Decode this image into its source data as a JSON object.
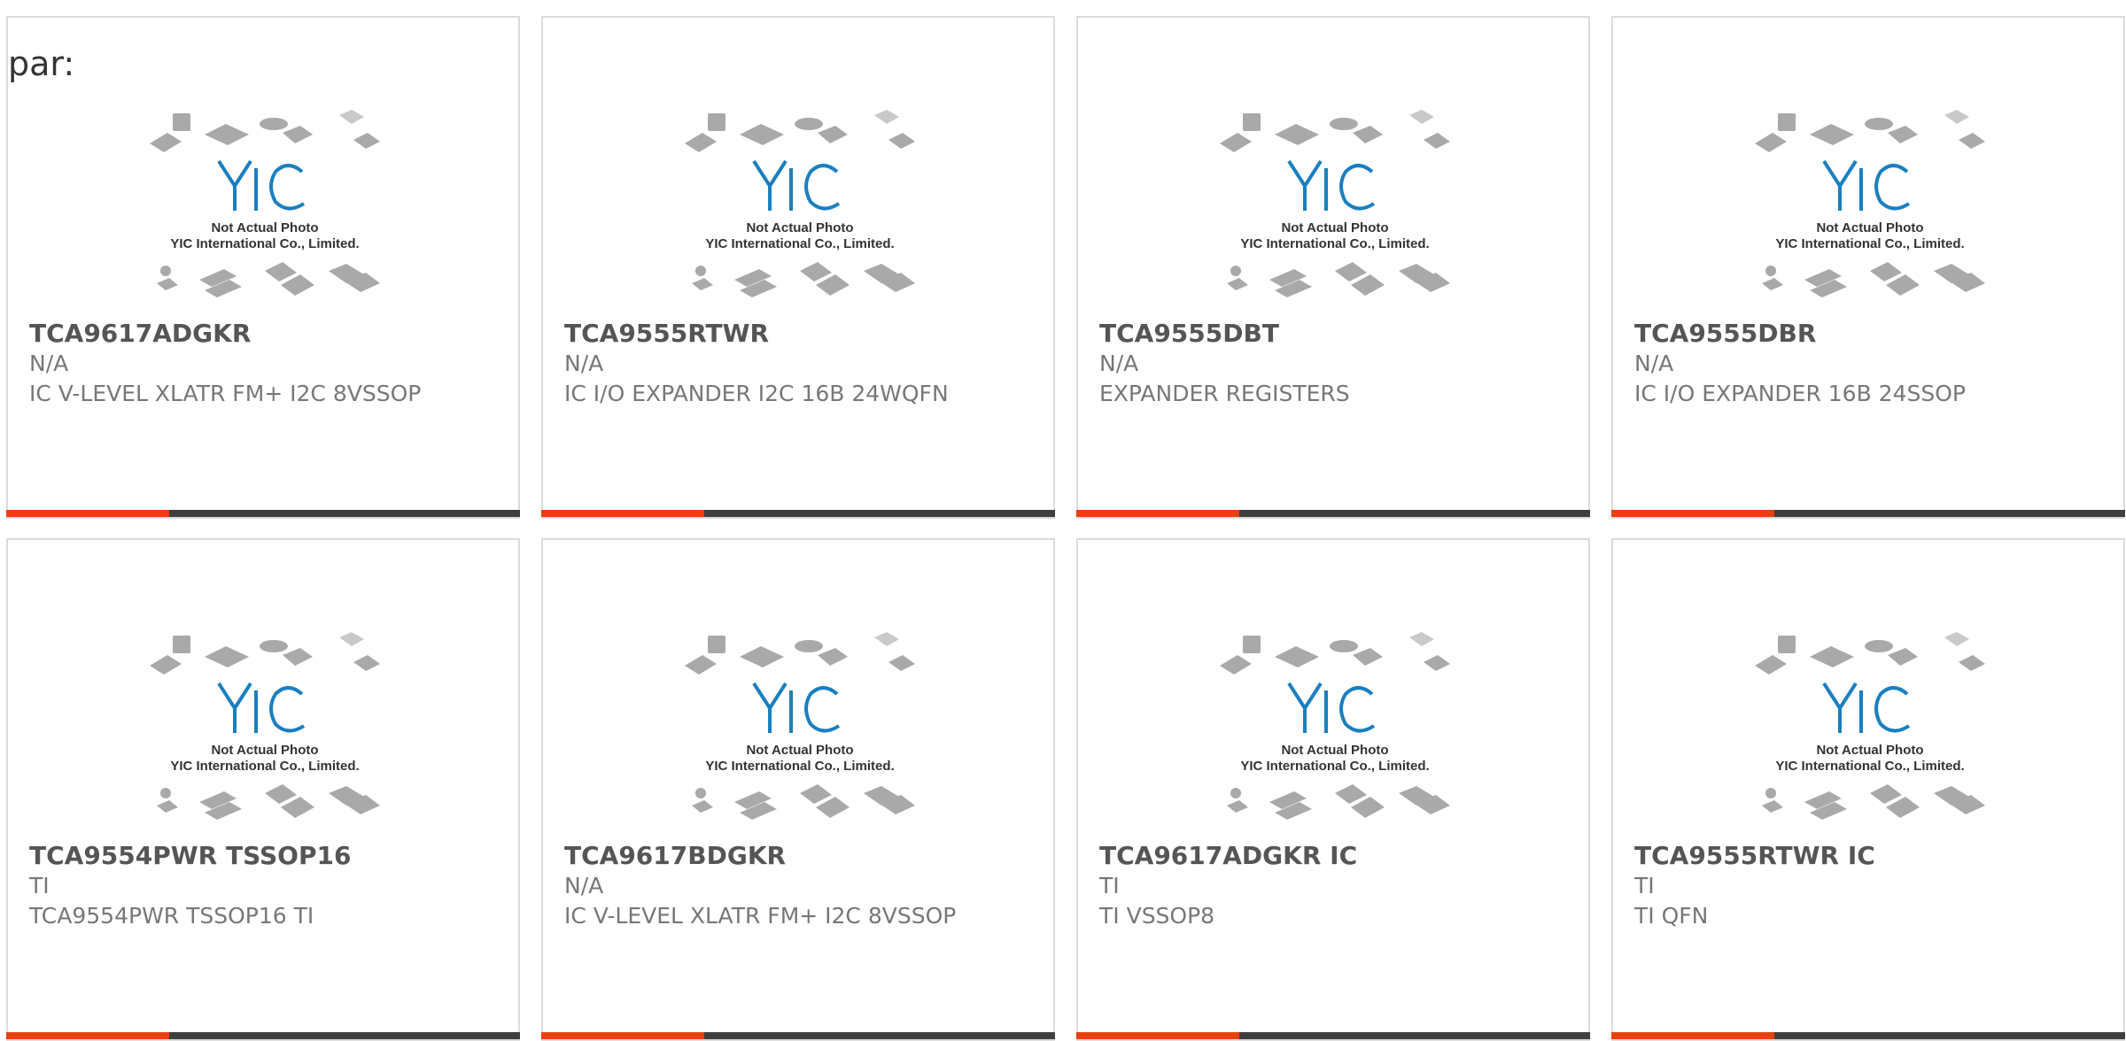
{
  "page": {
    "prefix_label": "par:"
  },
  "thumbnail": {
    "logo_text": "YIC",
    "caption_line1": "Not Actual Photo",
    "caption_line2": "YIC International Co., Limited."
  },
  "colors": {
    "accent": "#e8410f",
    "bar": "#3f3f3f",
    "logo_blue": "#1a7fc0",
    "chip_gray": "#a9a9a9"
  },
  "products": [
    {
      "part_number": "TCA9617ADGKR",
      "manufacturer": "N/A",
      "description": "IC V-LEVEL XLATR FM+ I2C 8VSSOP"
    },
    {
      "part_number": "TCA9555RTWR",
      "manufacturer": "N/A",
      "description": "IC I/O EXPANDER I2C 16B 24WQFN"
    },
    {
      "part_number": "TCA9555DBT",
      "manufacturer": "N/A",
      "description": "EXPANDER REGISTERS"
    },
    {
      "part_number": "TCA9555DBR",
      "manufacturer": "N/A",
      "description": "IC I/O EXPANDER 16B 24SSOP"
    },
    {
      "part_number": "TCA9554PWR TSSOP16",
      "manufacturer": "TI",
      "description": "TCA9554PWR TSSOP16 TI"
    },
    {
      "part_number": "TCA9617BDGKR",
      "manufacturer": "N/A",
      "description": "IC V-LEVEL XLATR FM+ I2C 8VSSOP"
    },
    {
      "part_number": "TCA9617ADGKR IC",
      "manufacturer": "TI",
      "description": "TI VSSOP8"
    },
    {
      "part_number": "TCA9555RTWR IC",
      "manufacturer": "TI",
      "description": "TI QFN"
    }
  ]
}
